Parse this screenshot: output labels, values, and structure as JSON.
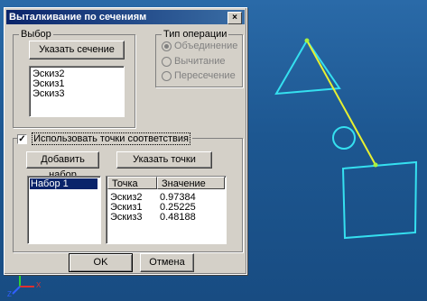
{
  "dialog": {
    "title": "Выталкивание по сечениям",
    "close_glyph": "×",
    "selection_group": {
      "title": "Выбор",
      "select_section_button": "Указать сечение",
      "sketches": [
        "Эскиз2",
        "Эскиз1",
        "Эскиз3"
      ]
    },
    "operation_group": {
      "title": "Тип операции",
      "options": [
        {
          "label": "Объединение",
          "checked": true
        },
        {
          "label": "Вычитание",
          "checked": false
        },
        {
          "label": "Пересечение",
          "checked": false
        }
      ]
    },
    "correspondence": {
      "checkbox_label": "Использовать точки соответствия",
      "checked": true,
      "check_glyph": "✓",
      "add_set_button": "Добавить набор",
      "specify_points_button": "Указать точки",
      "sets": [
        "Набор 1"
      ],
      "table": {
        "headers": [
          "Точка",
          "Значение"
        ],
        "rows": [
          [
            "Эскиз2",
            "0.97384"
          ],
          [
            "Эскиз1",
            "0.25225"
          ],
          [
            "Эскиз3",
            "0.48188"
          ]
        ]
      }
    },
    "ok_button": "OK",
    "cancel_button": "Отмена"
  },
  "viewport": {
    "axis_labels": [
      "Y",
      "X",
      "Z"
    ],
    "colors": {
      "background": "#1f5a96",
      "sketch": "#35e0f0",
      "path": "#e8f030",
      "point": "#a8f040"
    }
  }
}
